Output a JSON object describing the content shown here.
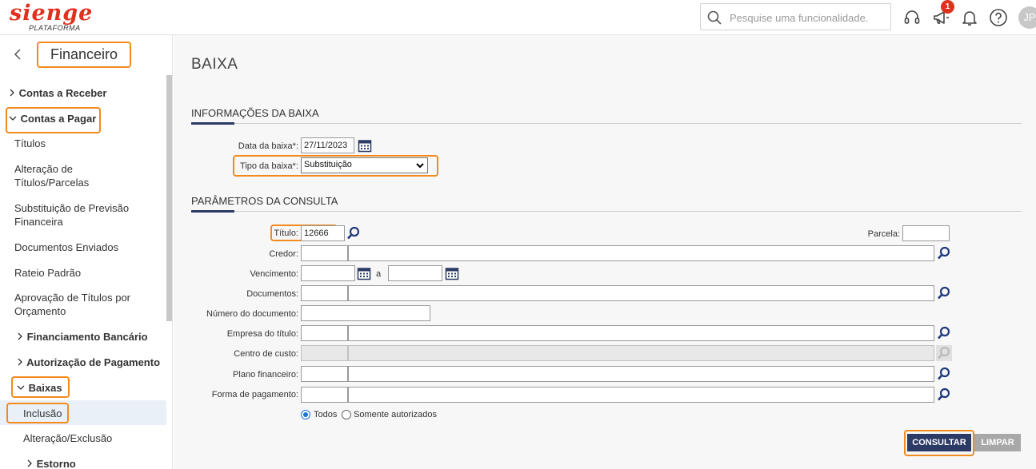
{
  "header": {
    "logo_main": "SIENGE",
    "logo_sub": "PLATAFORMA",
    "search_placeholder": "Pesquise uma funcionalidade.",
    "notification_count": "1",
    "avatar_initials": "JP"
  },
  "sidebar": {
    "module": "Financeiro",
    "items": [
      {
        "label": "Contas a Receber"
      },
      {
        "label": "Contas a Pagar"
      },
      {
        "label": "Títulos"
      },
      {
        "label": "Alteração de Títulos/Parcelas"
      },
      {
        "label": "Substituição de Previsão Financeira"
      },
      {
        "label": "Documentos Enviados"
      },
      {
        "label": "Rateio Padrão"
      },
      {
        "label": "Aprovação de Títulos por Orçamento"
      },
      {
        "label": "Financiamento Bancário"
      },
      {
        "label": "Autorização de Pagamento"
      },
      {
        "label": "Baixas"
      },
      {
        "label": "Inclusão"
      },
      {
        "label": "Alteração/Exclusão"
      },
      {
        "label": "Estorno"
      }
    ]
  },
  "main": {
    "title": "BAIXA",
    "section1": "INFORMAÇÕES DA BAIXA",
    "section2": "PARÂMETROS DA CONSULTA",
    "fields": {
      "data_baixa_label": "Data da baixa*:",
      "data_baixa_value": "27/11/2023",
      "tipo_baixa_label": "Tipo da baixa*:",
      "tipo_baixa_value": "Substituição",
      "titulo_label": "Título:",
      "titulo_value": "12666",
      "parcela_label": "Parcela:",
      "credor_label": "Credor:",
      "vencimento_label": "Vencimento:",
      "vencimento_sep": "a",
      "documentos_label": "Documentos:",
      "numero_documento_label": "Número do documento:",
      "empresa_label": "Empresa do título:",
      "centro_custo_label": "Centro de custo:",
      "plano_financeiro_label": "Plano financeiro:",
      "forma_pagamento_label": "Forma de pagamento:"
    },
    "radio": {
      "todos": "Todos",
      "somente_autorizados": "Somente autorizados"
    },
    "buttons": {
      "consultar": "CONSULTAR",
      "limpar": "LIMPAR"
    }
  },
  "colors": {
    "brand_red": "#e0311f",
    "highlight_orange": "#f28a1e",
    "primary_navy": "#2c3a66"
  }
}
